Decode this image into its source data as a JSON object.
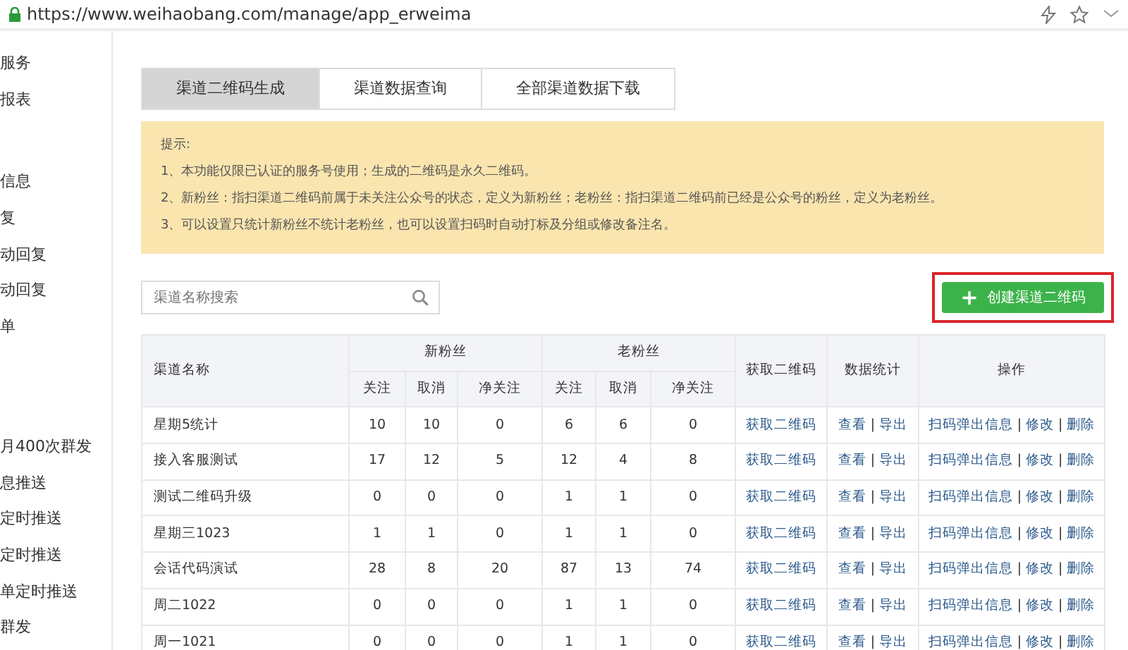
{
  "browser": {
    "url": "https://www.weihaobang.com/manage/app_erweima",
    "secure": true,
    "bookmarked": false
  },
  "sidebar": {
    "groups": [
      {
        "items": [
          "服务",
          "报表"
        ]
      },
      {
        "items": [
          "信息",
          "复",
          "动回复",
          "动回复",
          "单"
        ]
      },
      {
        "items": [
          "月400次群发",
          "息推送",
          "定时推送",
          "定时推送",
          "单定时推送",
          "群发"
        ]
      }
    ]
  },
  "tabs": [
    {
      "label": "渠道二维码生成",
      "selected": true
    },
    {
      "label": "渠道数据查询",
      "selected": false
    },
    {
      "label": "全部渠道数据下载",
      "selected": false
    }
  ],
  "notice": {
    "title": "提示:",
    "lines": [
      "1、本功能仅限已认证的服务号使用；生成的二维码是永久二维码。",
      "2、新粉丝：指扫渠道二维码前属于未关注公众号的状态，定义为新粉丝；老粉丝：指扫渠道二维码前已经是公众号的粉丝，定义为老粉丝。",
      "3、可以设置只统计新粉丝不统计老粉丝，也可以设置扫码时自动打标及分组或修改备注名。"
    ]
  },
  "search": {
    "placeholder": "渠道名称搜索"
  },
  "create_button": {
    "icon": "+",
    "label": "创建渠道二维码",
    "highlighted": true
  },
  "table": {
    "separator": "|",
    "header": {
      "name": "渠道名称",
      "groups": [
        {
          "label": "新粉丝",
          "columns": [
            "关注",
            "取消",
            "净关注"
          ]
        },
        {
          "label": "老粉丝",
          "columns": [
            "关注",
            "取消",
            "净关注"
          ]
        }
      ],
      "qrcode": "获取二维码",
      "stats": "数据统计",
      "actions": "操作"
    },
    "rows": [
      {
        "name": "星期5统计",
        "new": [
          "10",
          "10",
          "0"
        ],
        "old": [
          "6",
          "6",
          "0"
        ],
        "qrcode": "获取二维码",
        "stats": [
          "查看",
          "导出"
        ],
        "actions": [
          "扫码弹出信息",
          "修改",
          "删除"
        ]
      },
      {
        "name": "接入客服测试",
        "new": [
          "17",
          "12",
          "5"
        ],
        "old": [
          "12",
          "4",
          "8"
        ],
        "qrcode": "获取二维码",
        "stats": [
          "查看",
          "导出"
        ],
        "actions": [
          "扫码弹出信息",
          "修改",
          "删除"
        ]
      },
      {
        "name": "测试二维码升级",
        "new": [
          "0",
          "0",
          "0"
        ],
        "old": [
          "1",
          "1",
          "0"
        ],
        "qrcode": "获取二维码",
        "stats": [
          "查看",
          "导出"
        ],
        "actions": [
          "扫码弹出信息",
          "修改",
          "删除"
        ]
      },
      {
        "name": "星期三1023",
        "new": [
          "1",
          "1",
          "0"
        ],
        "old": [
          "1",
          "1",
          "0"
        ],
        "qrcode": "获取二维码",
        "stats": [
          "查看",
          "导出"
        ],
        "actions": [
          "扫码弹出信息",
          "修改",
          "删除"
        ]
      },
      {
        "name": "会话代码演试",
        "new": [
          "28",
          "8",
          "20"
        ],
        "old": [
          "87",
          "13",
          "74"
        ],
        "qrcode": "获取二维码",
        "stats": [
          "查看",
          "导出"
        ],
        "actions": [
          "扫码弹出信息",
          "修改",
          "删除"
        ]
      },
      {
        "name": "周二1022",
        "new": [
          "0",
          "0",
          "0"
        ],
        "old": [
          "1",
          "1",
          "0"
        ],
        "qrcode": "获取二维码",
        "stats": [
          "查看",
          "导出"
        ],
        "actions": [
          "扫码弹出信息",
          "修改",
          "删除"
        ]
      },
      {
        "name": "周一1021",
        "new": [
          "0",
          "0",
          "0"
        ],
        "old": [
          "1",
          "1",
          "0"
        ],
        "qrcode": "获取二维码",
        "stats": [
          "查看",
          "导出"
        ],
        "actions": [
          "扫码弹出信息",
          "修改",
          "删除"
        ]
      }
    ]
  }
}
